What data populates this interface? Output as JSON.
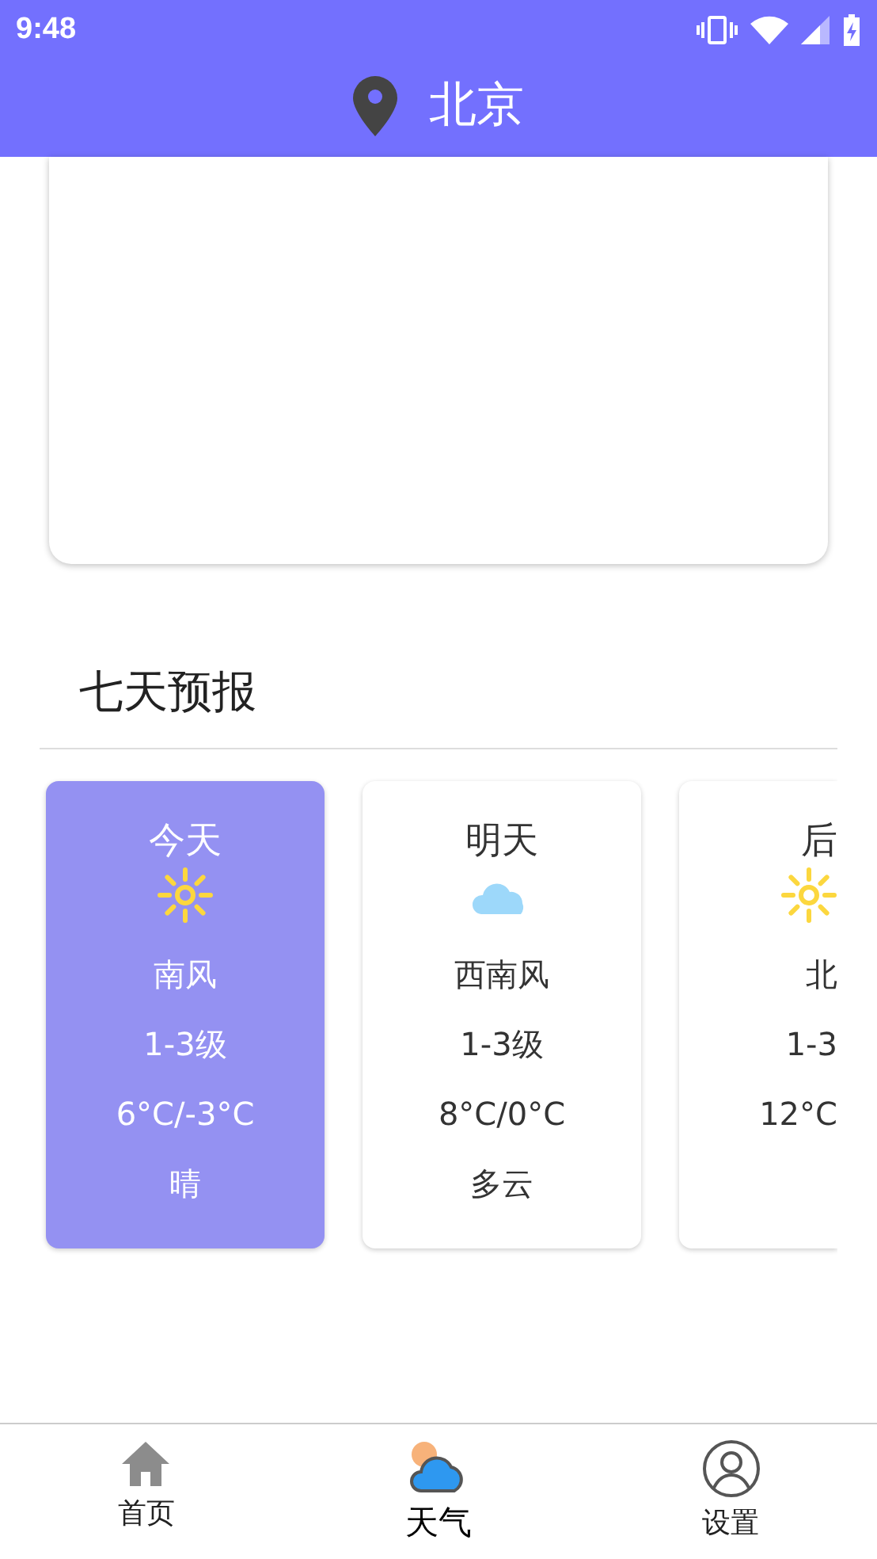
{
  "status_bar": {
    "time": "9:48"
  },
  "header": {
    "city": "北京"
  },
  "forecast": {
    "title": "七天预报",
    "days": [
      {
        "kind": "sunny",
        "clipped": false,
        "selected": true,
        "day": "今天",
        "wind": "南风",
        "level": "1-3级",
        "temp": "6°C/-3°C",
        "condition": "晴"
      },
      {
        "kind": "cloudy",
        "clipped": false,
        "selected": false,
        "day": "明天",
        "wind": "西南风",
        "level": "1-3级",
        "temp": "8°C/0°C",
        "condition": "多云"
      },
      {
        "kind": "sunny",
        "clipped": true,
        "selected": false,
        "day": "后",
        "wind": "北",
        "level": "1-3",
        "temp": "12°C"
      }
    ]
  },
  "nav": [
    {
      "label": "首页",
      "selected": false,
      "kind": "home"
    },
    {
      "label": "天气",
      "selected": true,
      "kind": "weather"
    },
    {
      "label": "设置",
      "selected": false,
      "kind": "profile"
    }
  ]
}
